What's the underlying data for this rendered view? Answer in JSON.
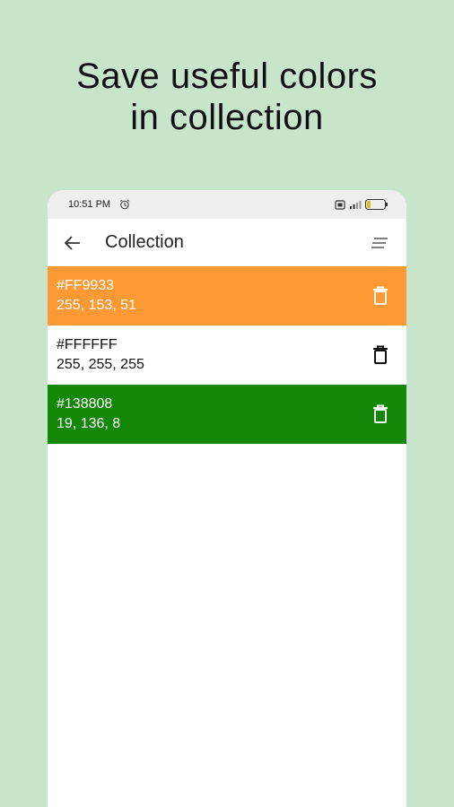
{
  "headline": {
    "line1": "Save useful colors",
    "line2": "in collection"
  },
  "status_bar": {
    "time": "10:51 PM",
    "battery": "15"
  },
  "app_bar": {
    "back_icon": "arrow-left-icon",
    "title": "Collection",
    "sort_icon": "sort-icon"
  },
  "colors": [
    {
      "hex": "#FF9933",
      "rgb": "255, 153, 51",
      "background": "#ff9933",
      "text_color": "#ffffff"
    },
    {
      "hex": "#FFFFFF",
      "rgb": "255, 255, 255",
      "background": "#ffffff",
      "text_color": "#111111"
    },
    {
      "hex": "#138808",
      "rgb": "19, 136, 8",
      "background": "#138808",
      "text_color": "#ffffff"
    }
  ],
  "theme": {
    "page_background": "#c8e5cb",
    "status_bar_background": "#eeeeee"
  }
}
